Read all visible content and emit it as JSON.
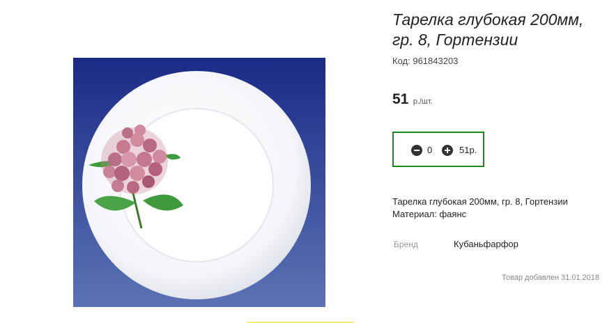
{
  "product": {
    "title": "Тарелка глубокая 200мм, гр. 8, Гортензии",
    "code_label": "Код:",
    "code_value": "961843203",
    "price_value": "51",
    "price_unit": "р./шт.",
    "image_icon": "plate-with-hydrangea-image",
    "description_line1": "Тарелка глубокая 200мм, гр. 8, Гортензии",
    "description_line2": "Материал: фаянс",
    "brand_label": "Бренд",
    "brand_value": "Кубаньфарфор",
    "added_date": "Товар добавлен 31.01.2018"
  },
  "cart": {
    "quantity": "0",
    "total": "51р.",
    "minus_icon": "minus-circle-icon",
    "plus_icon": "plus-circle-icon",
    "border_color": "#1d8a1d"
  },
  "colors": {
    "image_background_top": "#1b2a86",
    "image_background_bottom": "#5b73b4"
  }
}
